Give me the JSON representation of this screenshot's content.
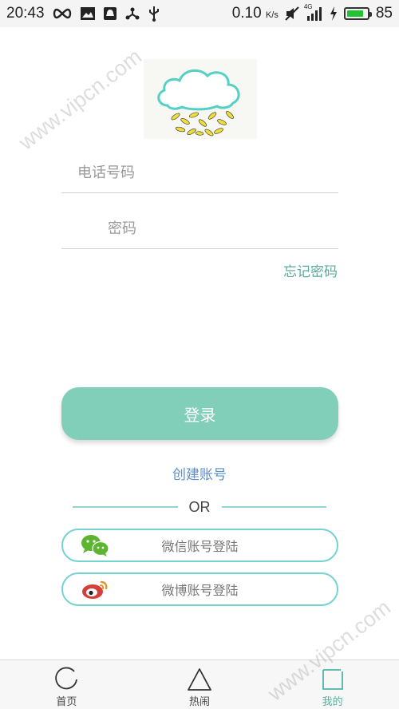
{
  "status_bar": {
    "time": "20:43",
    "speed": "0.10",
    "speed_unit": "K/s",
    "network": "4G",
    "battery": "85",
    "battery_fraction": 0.85,
    "icons": [
      "infinity-icon",
      "image-icon",
      "notification-icon",
      "share-icon",
      "usb-icon",
      "mute-icon",
      "signal-icon",
      "charging-icon",
      "battery-icon"
    ]
  },
  "form": {
    "phone_placeholder": "电话号码",
    "password_placeholder": "密码",
    "forgot_label": "忘记密码",
    "login_label": "登录",
    "create_label": "创建账号",
    "or_label": "OR",
    "wechat_label": "微信账号登陆",
    "weibo_label": "微博账号登陆"
  },
  "tabs": [
    {
      "label": "首页",
      "icon": "circle-icon"
    },
    {
      "label": "热闹",
      "icon": "triangle-icon"
    },
    {
      "label": "我的",
      "icon": "square-icon",
      "active": true
    }
  ],
  "watermark": "www.vipcn.com",
  "colors": {
    "accent": "#82cfb9",
    "accent_text": "#5aa99b",
    "link": "#5a8fc8",
    "outline": "#74d3cf",
    "wechat": "#5bb530",
    "weibo": "#d6403a"
  }
}
